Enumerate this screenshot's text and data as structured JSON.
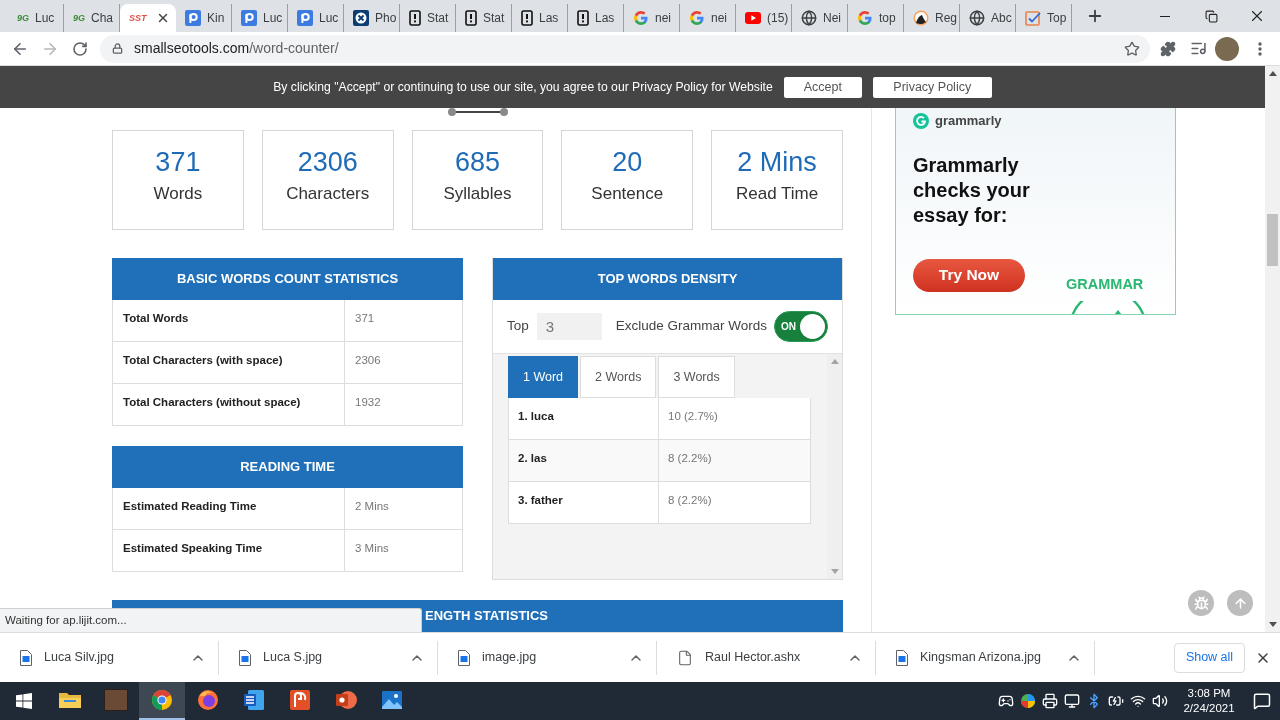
{
  "browser": {
    "tabs": [
      {
        "kind": "text",
        "favicon_text": "9G",
        "color": "#3d8b37",
        "title": "Luc",
        "selected": false
      },
      {
        "kind": "text",
        "favicon_text": "9G",
        "color": "#3d8b37",
        "title": "Cha",
        "selected": false
      },
      {
        "kind": "text",
        "favicon_text": "SST",
        "color": "#e0524a",
        "selected": true
      },
      {
        "kind": "p-square",
        "title": "Kin",
        "selected": false
      },
      {
        "kind": "p-square",
        "title": "Luc",
        "selected": false
      },
      {
        "kind": "p-square",
        "title": "Luc",
        "selected": false
      },
      {
        "kind": "x-circle",
        "title": "Pho",
        "selected": false
      },
      {
        "kind": "phone",
        "title": "Stat",
        "selected": false
      },
      {
        "kind": "phone",
        "title": "Stat",
        "selected": false
      },
      {
        "kind": "phone",
        "title": "Las",
        "selected": false
      },
      {
        "kind": "phone",
        "title": "Las",
        "selected": false
      },
      {
        "kind": "google",
        "title": "nei",
        "selected": false
      },
      {
        "kind": "google",
        "title": "nei",
        "selected": false
      },
      {
        "kind": "youtube",
        "title": "(15)",
        "selected": false
      },
      {
        "kind": "globe",
        "title": "Nei",
        "selected": false
      },
      {
        "kind": "google",
        "title": "top",
        "selected": false
      },
      {
        "kind": "avatar",
        "title": "Reg",
        "selected": false
      },
      {
        "kind": "globe",
        "title": "Abc",
        "selected": false
      },
      {
        "kind": "checklist",
        "title": "Top",
        "selected": false
      }
    ],
    "url": {
      "host": "smallseotools.com",
      "path": "/word-counter/"
    }
  },
  "cookie_banner": {
    "message": "By clicking \"Accept\" or continuing to use our site, you agree to our Privacy Policy for Website",
    "buttons": [
      "Accept",
      "Privacy Policy"
    ]
  },
  "stats": [
    {
      "value": "371",
      "label": "Words"
    },
    {
      "value": "2306",
      "label": "Characters"
    },
    {
      "value": "685",
      "label": "Syllables"
    },
    {
      "value": "20",
      "label": "Sentence"
    },
    {
      "value": "2 Mins",
      "label": "Read Time"
    }
  ],
  "basic_stats": {
    "title": "BASIC WORDS COUNT STATISTICS",
    "rows": [
      {
        "label": "Total Words",
        "value": "371"
      },
      {
        "label": "Total Characters (with space)",
        "value": "2306"
      },
      {
        "label": "Total Characters (without space)",
        "value": "1932"
      }
    ]
  },
  "reading_time": {
    "title": "READING TIME",
    "rows": [
      {
        "label": "Estimated Reading Time",
        "value": "2 Mins"
      },
      {
        "label": "Estimated Speaking Time",
        "value": "3 Mins"
      }
    ]
  },
  "top_words": {
    "title": "TOP WORDS DENSITY",
    "top_label": "Top",
    "top_value": "3",
    "exclude_label": "Exclude Grammar Words",
    "exclude_toggle": {
      "on": true,
      "label": "ON"
    },
    "tabs": [
      {
        "label": "1 Word",
        "selected": true
      },
      {
        "label": "2 Words",
        "selected": false
      },
      {
        "label": "3 Words",
        "selected": false
      }
    ],
    "rows": [
      {
        "word": "1. luca",
        "count": "10 (2.7%)"
      },
      {
        "word": "2. las",
        "count": "8 (2.2%)"
      },
      {
        "word": "3. father",
        "count": "8 (2.2%)"
      }
    ]
  },
  "next_section": {
    "title": "ENGTH STATISTICS"
  },
  "ad": {
    "brand": "grammarly",
    "headline": "Grammarly checks your essay for:",
    "button": "Try Now",
    "tag": "GRAMMAR"
  },
  "status_text": "Waiting for ap.lijit.com...",
  "downloads": {
    "items": [
      {
        "kind": "image",
        "name": "Luca Silv.jpg"
      },
      {
        "kind": "image",
        "name": "Luca S.jpg"
      },
      {
        "kind": "image",
        "name": "image.jpg"
      },
      {
        "kind": "file",
        "name": "Raul Hector.ashx"
      },
      {
        "kind": "image",
        "name": "Kingsman Arizona.jpg"
      }
    ],
    "show_all": "Show all"
  },
  "taskbar": {
    "apps": [
      {
        "kind": "folder",
        "selected": false
      },
      {
        "kind": "picture",
        "selected": false
      },
      {
        "kind": "chrome",
        "selected": true
      },
      {
        "kind": "firefox",
        "selected": false
      },
      {
        "kind": "word",
        "selected": false
      },
      {
        "kind": "document-app",
        "selected": false
      },
      {
        "kind": "powerpoint",
        "selected": false
      },
      {
        "kind": "photos",
        "selected": false
      }
    ],
    "time": "3:08 PM",
    "date": "2/24/2021"
  }
}
